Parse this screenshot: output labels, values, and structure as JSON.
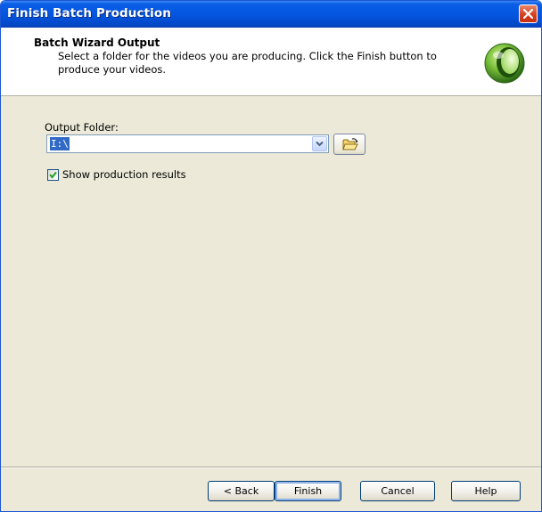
{
  "window": {
    "title": "Finish Batch Production",
    "close_icon": "close-icon"
  },
  "header": {
    "title": "Batch Wizard Output",
    "description": "Select a folder for the videos you are producing.  Click the Finish button to produce your videos.",
    "logo_icon": "green-orb-logo"
  },
  "form": {
    "output_folder_label": "Output Folder:",
    "output_folder_value": "I:\\",
    "browse_icon": "open-folder-icon",
    "show_results_label": "Show production results",
    "show_results_checked": true
  },
  "buttons": {
    "back": "< Back",
    "finish": "Finish",
    "cancel": "Cancel",
    "help": "Help"
  }
}
